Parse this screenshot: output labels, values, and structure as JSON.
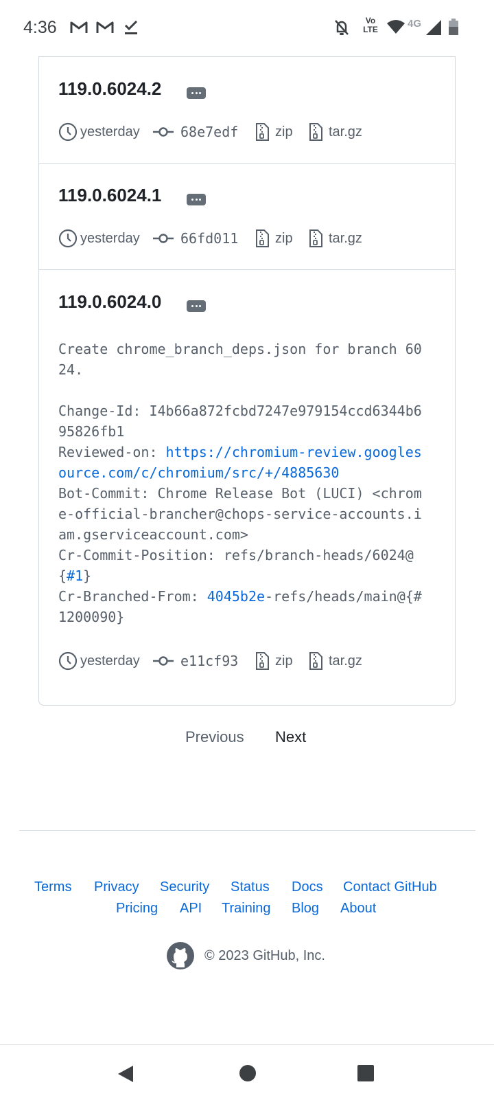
{
  "status_bar": {
    "time": "4:36",
    "notification_icons": [
      "gmail-icon",
      "gmail-icon",
      "check-icon"
    ],
    "system_icons": [
      "bell-off-icon",
      "volte-icon",
      "wifi-icon",
      "signal-4g-icon",
      "battery-icon"
    ],
    "volte_line1": "Vo",
    "volte_line2": "LTE",
    "network": "4G"
  },
  "releases": [
    {
      "tag": "119.0.6024.2",
      "time": "yesterday",
      "commit": "68e7edf",
      "zip_label": "zip",
      "targz_label": "tar.gz"
    },
    {
      "tag": "119.0.6024.1",
      "time": "yesterday",
      "commit": "66fd011",
      "zip_label": "zip",
      "targz_label": "tar.gz"
    },
    {
      "tag": "119.0.6024.0",
      "time": "yesterday",
      "commit": "e11cf93",
      "zip_label": "zip",
      "targz_label": "tar.gz",
      "notes": {
        "summary": "Create chrome_branch_deps.json for branch 6024.",
        "change_id_label": "Change-Id: ",
        "change_id": "I4b66a872fcbd7247e979154ccd6344b695826fb1",
        "reviewed_on_label": "Reviewed-on: ",
        "reviewed_on_link": "https://chromium-review.googlesource.com/c/chromium/src/+/4885630",
        "bot_commit": "Bot-Commit: Chrome Release Bot (LUCI) <chrome-official-brancher@chops-service-accounts.iam.gserviceaccount.com>",
        "commit_position_prefix": "Cr-Commit-Position: refs/branch-heads/6024@{",
        "commit_position_link": "#1",
        "commit_position_suffix": "}",
        "branched_from_label": "Cr-Branched-From: ",
        "branched_from_link": "4045b2e",
        "branched_from_rest": "-refs/heads/main@{#1200090}"
      }
    }
  ],
  "pagination": {
    "previous": "Previous",
    "next": "Next"
  },
  "footer": {
    "row1": [
      "Terms",
      "Privacy",
      "Security",
      "Status",
      "Docs",
      "Contact GitHub"
    ],
    "row2": [
      "Pricing",
      "API",
      "Training",
      "Blog",
      "About"
    ],
    "copyright": "© 2023 GitHub, Inc.",
    "link_color": "#0969da"
  },
  "nav_bar": {
    "buttons": [
      "back-icon",
      "home-icon",
      "recents-icon"
    ]
  }
}
